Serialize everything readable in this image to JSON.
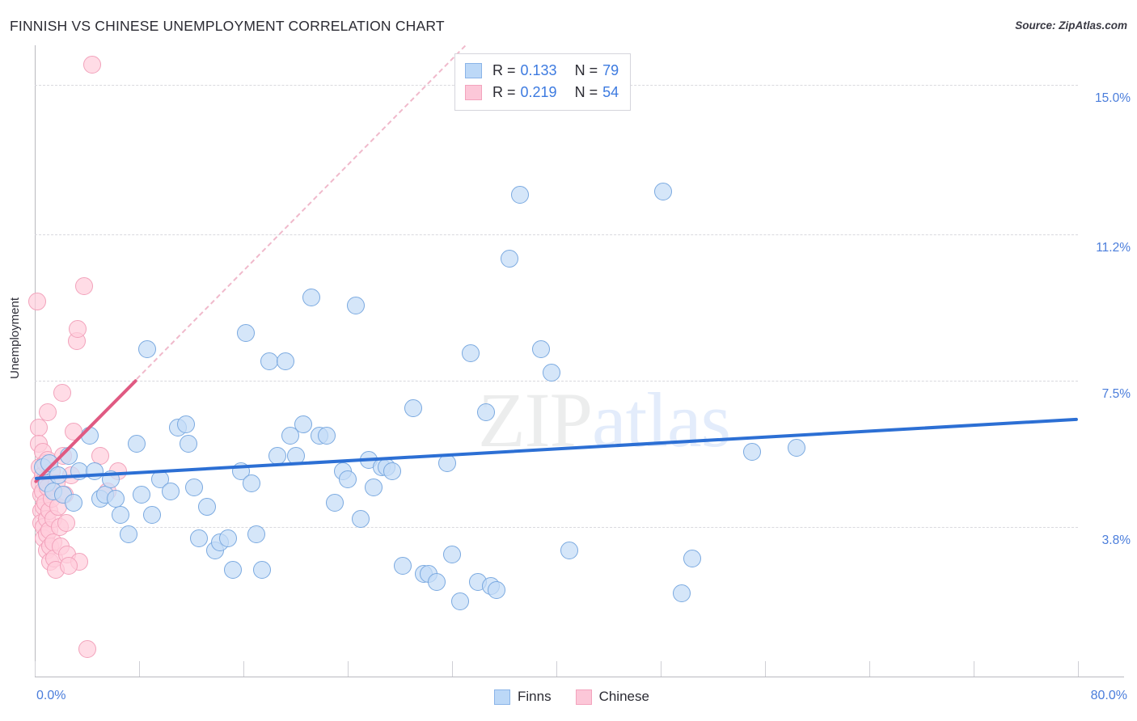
{
  "header": {
    "title": "FINNISH VS CHINESE UNEMPLOYMENT CORRELATION CHART",
    "source": "Source: ZipAtlas.com"
  },
  "watermark": {
    "part1": "ZIP",
    "part2": "atlas"
  },
  "axes": {
    "y_title": "Unemployment",
    "y_ticks": [
      "15.0%",
      "11.2%",
      "7.5%",
      "3.8%"
    ],
    "x_min_label": "0.0%",
    "x_max_label": "80.0%"
  },
  "stats_legend": {
    "rows": [
      {
        "color": "blue",
        "r_label": "R =",
        "r_value": "0.133",
        "n_label": "N =",
        "n_value": "79"
      },
      {
        "color": "pink",
        "r_label": "R =",
        "r_value": "0.219",
        "n_label": "N =",
        "n_value": "54"
      }
    ]
  },
  "series_legend": [
    {
      "name": "Finns",
      "color": "blue"
    },
    {
      "name": "Chinese",
      "color": "pink"
    }
  ],
  "colors": {
    "blue_fill": "#c5ddf7",
    "blue_stroke": "#7aa9e0",
    "pink_fill": "#ffcddb",
    "pink_stroke": "#f2a2bb",
    "blue_trend": "#2c6fd4",
    "pink_trend": "#e05a82",
    "tick_text": "#4a7ddb"
  },
  "chart_data": {
    "type": "scatter",
    "title": "FINNISH VS CHINESE UNEMPLOYMENT CORRELATION CHART",
    "xlabel": "",
    "ylabel": "Unemployment",
    "xlim": [
      0.0,
      80.0
    ],
    "ylim": [
      0.0,
      16.0
    ],
    "x_unit": "%",
    "y_unit": "%",
    "grid": true,
    "y_gridlines": [
      15.0,
      11.2,
      7.5,
      3.8
    ],
    "legend_position": "bottom-center",
    "series": [
      {
        "name": "Finns",
        "color": "#c5ddf7",
        "R": 0.133,
        "N": 79,
        "trendline": {
          "x0": 0.0,
          "y0": 5.05,
          "x1": 80.0,
          "y1": 6.55,
          "style": "solid"
        },
        "points": [
          [
            0.6,
            5.3
          ],
          [
            0.9,
            4.9
          ],
          [
            1.1,
            5.4
          ],
          [
            1.4,
            4.7
          ],
          [
            1.8,
            5.1
          ],
          [
            2.2,
            4.6
          ],
          [
            2.6,
            5.6
          ],
          [
            3.0,
            4.4
          ],
          [
            3.4,
            5.2
          ],
          [
            4.2,
            6.1
          ],
          [
            4.6,
            5.2
          ],
          [
            5.0,
            4.5
          ],
          [
            5.4,
            4.6
          ],
          [
            5.8,
            5.0
          ],
          [
            6.2,
            4.5
          ],
          [
            6.6,
            4.1
          ],
          [
            7.2,
            3.6
          ],
          [
            7.8,
            5.9
          ],
          [
            8.2,
            4.6
          ],
          [
            8.6,
            8.3
          ],
          [
            9.0,
            4.1
          ],
          [
            9.6,
            5.0
          ],
          [
            10.4,
            4.7
          ],
          [
            11.0,
            6.3
          ],
          [
            11.6,
            6.4
          ],
          [
            11.8,
            5.9
          ],
          [
            12.2,
            4.8
          ],
          [
            12.6,
            3.5
          ],
          [
            13.2,
            4.3
          ],
          [
            13.8,
            3.2
          ],
          [
            14.2,
            3.4
          ],
          [
            14.8,
            3.5
          ],
          [
            15.2,
            2.7
          ],
          [
            15.8,
            5.2
          ],
          [
            16.2,
            8.7
          ],
          [
            16.6,
            4.9
          ],
          [
            17.0,
            3.6
          ],
          [
            17.4,
            2.7
          ],
          [
            18.0,
            8.0
          ],
          [
            18.6,
            5.6
          ],
          [
            19.2,
            8.0
          ],
          [
            19.6,
            6.1
          ],
          [
            20.0,
            5.6
          ],
          [
            20.6,
            6.4
          ],
          [
            21.2,
            9.6
          ],
          [
            21.8,
            6.1
          ],
          [
            22.4,
            6.1
          ],
          [
            23.0,
            4.4
          ],
          [
            23.6,
            5.2
          ],
          [
            24.0,
            5.0
          ],
          [
            24.6,
            9.4
          ],
          [
            25.0,
            4.0
          ],
          [
            25.6,
            5.5
          ],
          [
            26.0,
            4.8
          ],
          [
            26.6,
            5.3
          ],
          [
            27.0,
            5.3
          ],
          [
            27.4,
            5.2
          ],
          [
            28.2,
            2.8
          ],
          [
            29.0,
            6.8
          ],
          [
            29.8,
            2.6
          ],
          [
            30.2,
            2.6
          ],
          [
            30.8,
            2.4
          ],
          [
            31.6,
            5.4
          ],
          [
            32.0,
            3.1
          ],
          [
            32.6,
            1.9
          ],
          [
            33.4,
            8.2
          ],
          [
            34.0,
            2.4
          ],
          [
            34.6,
            6.7
          ],
          [
            35.0,
            2.3
          ],
          [
            35.4,
            2.2
          ],
          [
            36.4,
            10.6
          ],
          [
            37.2,
            12.2
          ],
          [
            38.8,
            8.3
          ],
          [
            39.6,
            7.7
          ],
          [
            41.0,
            3.2
          ],
          [
            48.2,
            12.3
          ],
          [
            50.4,
            3.0
          ],
          [
            49.6,
            2.1
          ],
          [
            55.0,
            5.7
          ],
          [
            58.4,
            5.8
          ]
        ]
      },
      {
        "name": "Chinese",
        "color": "#ffcddb",
        "R": 0.219,
        "N": 54,
        "trendline": {
          "x0": 0.0,
          "y0": 4.95,
          "x1": 7.8,
          "y1": 7.55,
          "style": "solid"
        },
        "trendline_extension": {
          "x0": 7.8,
          "y0": 7.55,
          "x1": 33.0,
          "y1": 16.0,
          "style": "dashed"
        },
        "points": [
          [
            0.2,
            9.5
          ],
          [
            0.3,
            6.3
          ],
          [
            0.3,
            5.9
          ],
          [
            0.4,
            5.3
          ],
          [
            0.4,
            4.9
          ],
          [
            0.5,
            4.6
          ],
          [
            0.5,
            4.2
          ],
          [
            0.5,
            3.9
          ],
          [
            0.6,
            5.7
          ],
          [
            0.6,
            5.1
          ],
          [
            0.6,
            4.7
          ],
          [
            0.7,
            4.3
          ],
          [
            0.7,
            3.8
          ],
          [
            0.7,
            3.5
          ],
          [
            0.8,
            5.4
          ],
          [
            0.8,
            5.0
          ],
          [
            0.8,
            4.4
          ],
          [
            0.9,
            4.0
          ],
          [
            0.9,
            3.6
          ],
          [
            0.9,
            3.2
          ],
          [
            1.0,
            6.7
          ],
          [
            1.0,
            5.5
          ],
          [
            1.0,
            4.8
          ],
          [
            1.1,
            4.2
          ],
          [
            1.1,
            3.7
          ],
          [
            1.2,
            3.3
          ],
          [
            1.2,
            2.9
          ],
          [
            1.3,
            5.2
          ],
          [
            1.3,
            4.5
          ],
          [
            1.4,
            4.0
          ],
          [
            1.4,
            3.4
          ],
          [
            1.5,
            3.0
          ],
          [
            1.6,
            2.7
          ],
          [
            1.7,
            4.9
          ],
          [
            1.8,
            4.3
          ],
          [
            1.9,
            3.8
          ],
          [
            2.0,
            3.3
          ],
          [
            2.1,
            7.2
          ],
          [
            2.2,
            5.6
          ],
          [
            2.3,
            4.6
          ],
          [
            2.4,
            3.9
          ],
          [
            2.5,
            3.1
          ],
          [
            2.8,
            5.1
          ],
          [
            3.0,
            6.2
          ],
          [
            3.2,
            8.5
          ],
          [
            3.3,
            8.8
          ],
          [
            3.4,
            2.9
          ],
          [
            3.8,
            9.9
          ],
          [
            4.4,
            15.5
          ],
          [
            5.0,
            5.6
          ],
          [
            5.6,
            4.7
          ],
          [
            6.4,
            5.2
          ],
          [
            4.0,
            0.7
          ],
          [
            2.6,
            2.8
          ]
        ]
      }
    ]
  }
}
